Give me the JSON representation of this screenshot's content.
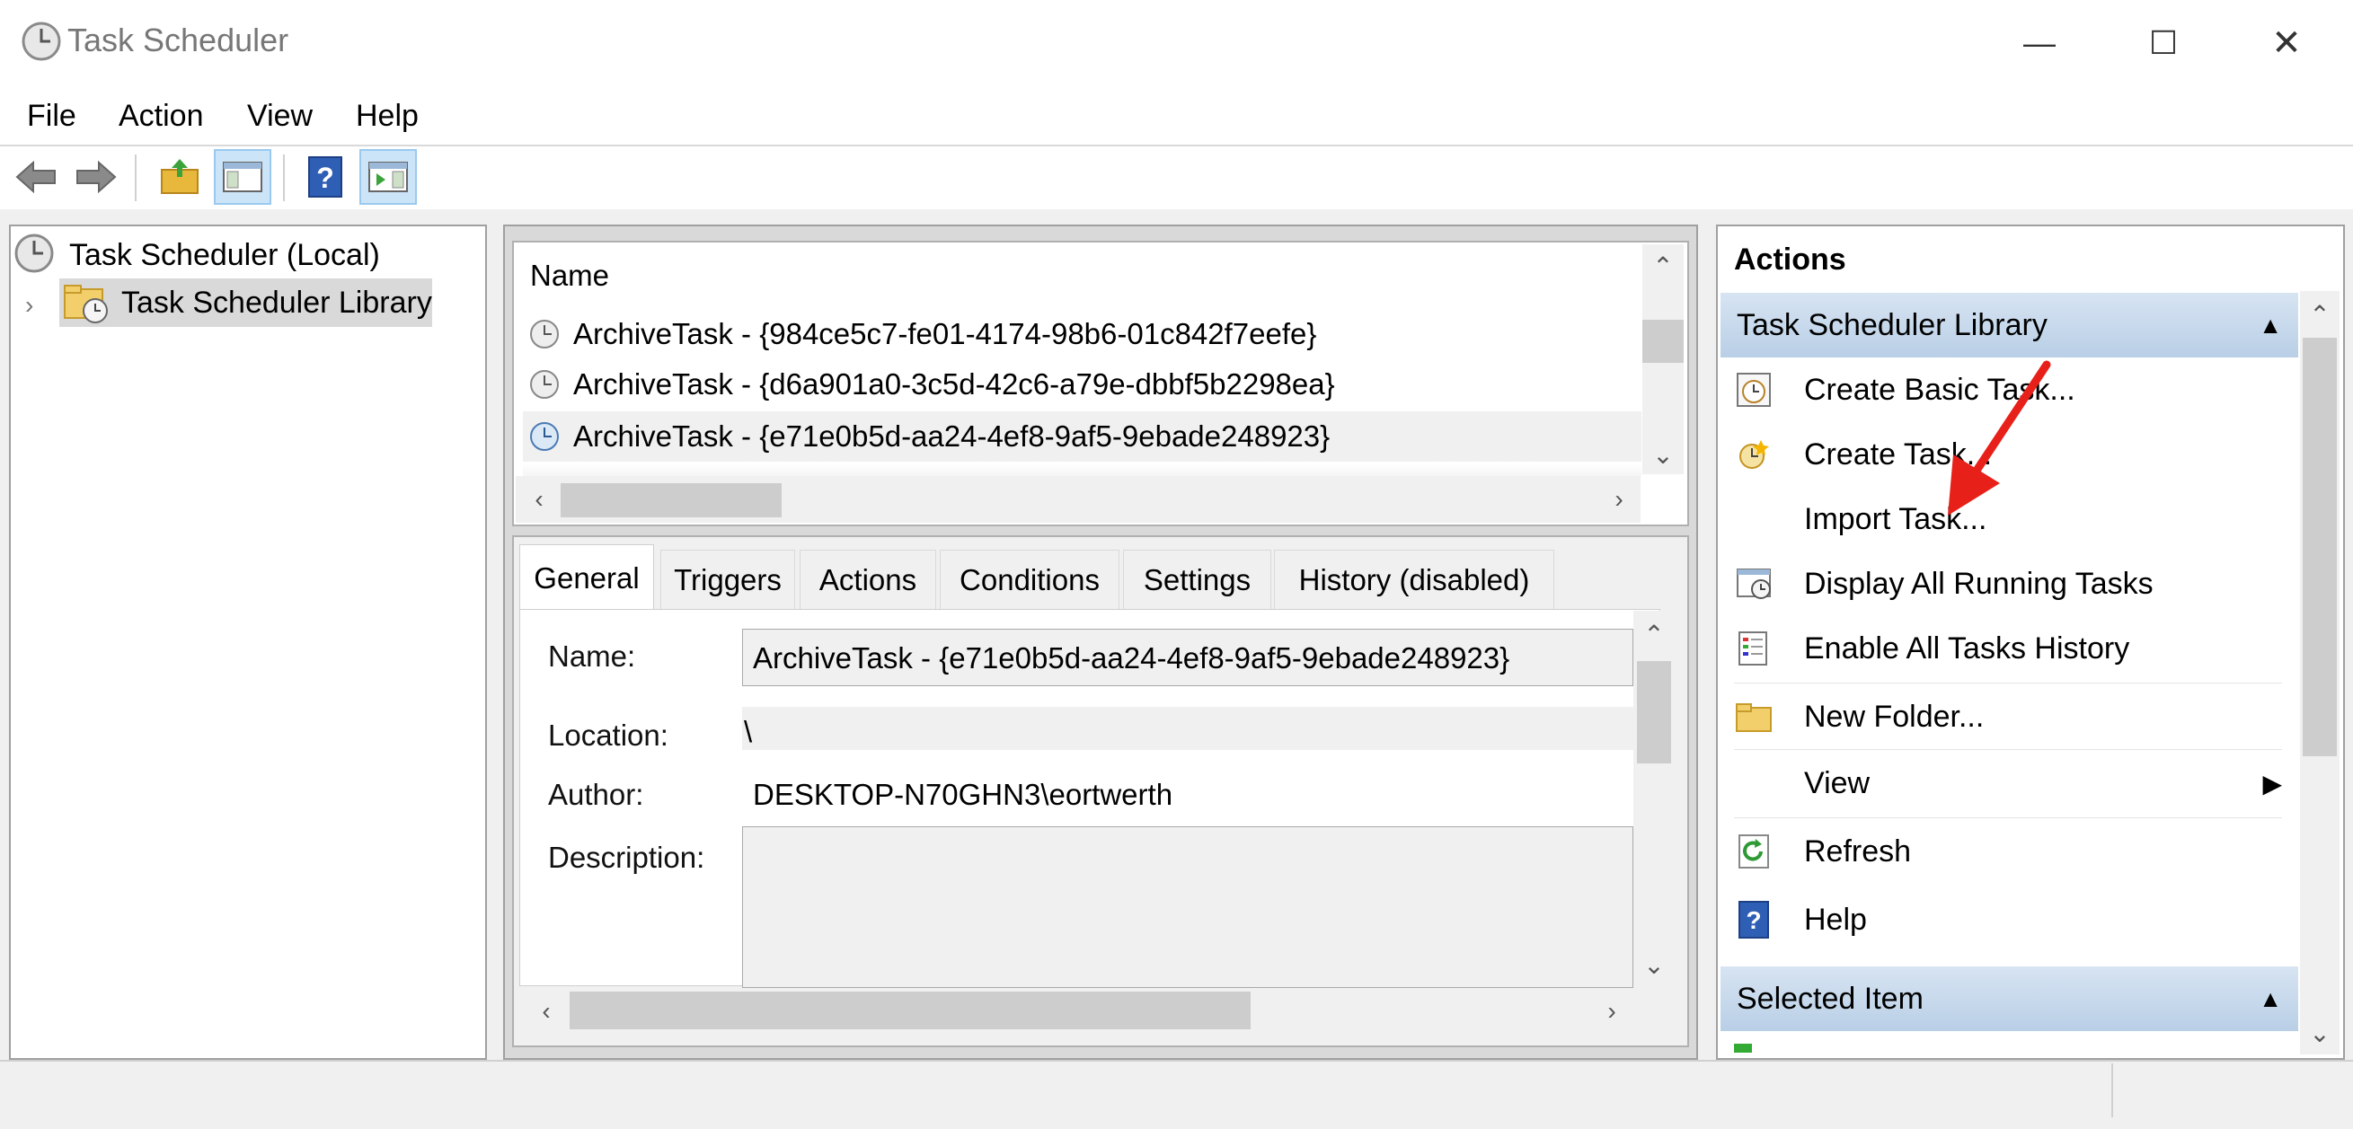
{
  "window": {
    "title": "Task Scheduler",
    "controls": [
      "minimize",
      "maximize",
      "close"
    ]
  },
  "menu": [
    "File",
    "Action",
    "View",
    "Help"
  ],
  "toolbar": {
    "buttons": [
      "back-arrow-icon",
      "forward-arrow-icon",
      "up-folder-icon",
      "show-hide-console-tree-icon",
      "help-icon",
      "show-hide-action-pane-icon"
    ]
  },
  "tree": {
    "root": "Task Scheduler (Local)",
    "child": "Task Scheduler Library"
  },
  "task_list": {
    "column_header": "Name",
    "rows": [
      "ArchiveTask - {984ce5c7-fe01-4174-98b6-01c842f7eefe}",
      "ArchiveTask - {d6a901a0-3c5d-42c6-a79e-dbbf5b2298ea}",
      "ArchiveTask - {e71e0b5d-aa24-4ef8-9af5-9ebade248923}"
    ]
  },
  "details": {
    "tabs": [
      "General",
      "Triggers",
      "Actions",
      "Conditions",
      "Settings",
      "History (disabled)"
    ],
    "general": {
      "name_label": "Name:",
      "name_value": "ArchiveTask - {e71e0b5d-aa24-4ef8-9af5-9ebade248923}",
      "location_label": "Location:",
      "location_value": "\\",
      "author_label": "Author:",
      "author_value": "DESKTOP-N70GHN3\\eortwerth",
      "description_label": "Description:"
    }
  },
  "actions_pane": {
    "title": "Actions",
    "library_header": "Task Scheduler Library",
    "items": [
      "Create Basic Task...",
      "Create Task...",
      "Import Task...",
      "Display All Running Tasks",
      "Enable All Tasks History",
      "New Folder...",
      "View",
      "Refresh",
      "Help"
    ],
    "selected_header": "Selected Item"
  },
  "colors": {
    "section_header": "#c7d9ee",
    "annotation_arrow": "#e8201a",
    "help_icon": "#2f5fb5"
  }
}
